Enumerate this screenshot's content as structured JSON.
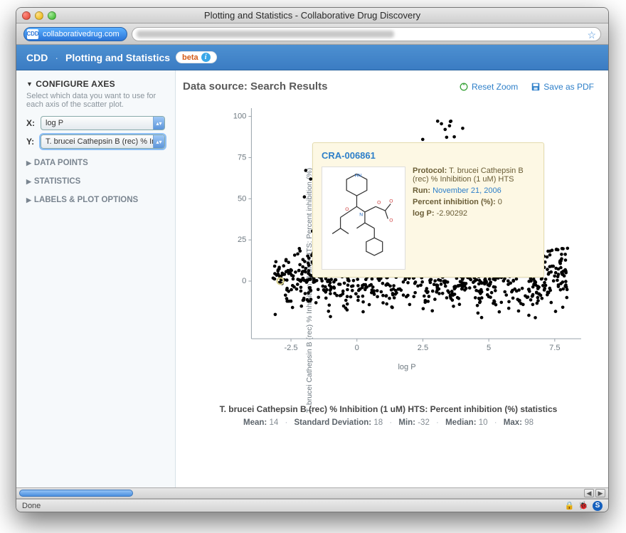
{
  "window": {
    "title": "Plotting and Statistics - Collaborative Drug Discovery"
  },
  "url": {
    "favicon_text": "CDD",
    "domain": "collaborativedrug.com"
  },
  "header": {
    "brand": "CDD",
    "page": "Plotting and Statistics",
    "badge_label": "beta"
  },
  "sidebar": {
    "configure_title": "CONFIGURE AXES",
    "configure_desc": "Select which data you want to use for each axis of the scatter plot.",
    "x_label": "X:",
    "y_label": "Y:",
    "x_select": "log P",
    "y_select": "T. brucei Cathepsin B (rec) % In",
    "sections": [
      "DATA POINTS",
      "STATISTICS",
      "LABELS & PLOT OPTIONS"
    ]
  },
  "main": {
    "title": "Data source: Search Results",
    "reset_zoom": "Reset Zoom",
    "save_pdf": "Save as PDF",
    "xlabel": "log P",
    "ylabel": "T. brucei Cathepsin B (rec) % Inhibition (1 uM) HTS: Percent inhibition (%)"
  },
  "tooltip": {
    "id": "CRA-006861",
    "protocol_label": "Protocol:",
    "protocol": "T. brucei Cathepsin B (rec) % Inhibition (1 uM) HTS",
    "run_label": "Run:",
    "run": "November 21, 2006",
    "pct_label": "Percent inhibition (%):",
    "pct": "0",
    "logp_label": "log P:",
    "logp": "-2.90292"
  },
  "stats": {
    "title": "T. brucei Cathepsin B (rec) % Inhibition (1 uM) HTS: Percent inhibition (%) statistics",
    "mean_label": "Mean:",
    "mean": "14",
    "sd_label": "Standard Deviation:",
    "sd": "18",
    "min_label": "Min:",
    "min": "-32",
    "median_label": "Median:",
    "median": "10",
    "max_label": "Max:",
    "max": "98"
  },
  "statusbar": {
    "text": "Done"
  },
  "chart_data": {
    "type": "scatter",
    "xlabel": "log P",
    "ylabel": "T. brucei Cathepsin B (rec) % Inhibition (1 uM) HTS: Percent inhibition (%)",
    "xlim": [
      -4,
      8.5
    ],
    "ylim": [
      -35,
      105
    ],
    "xticks": [
      -2.5,
      0,
      2.5,
      5,
      7.5
    ],
    "yticks": [
      0,
      25,
      50,
      75,
      100
    ],
    "n_points_approx": 900,
    "highlighted_point": {
      "x": -2.90292,
      "y": 0,
      "id": "CRA-006861"
    },
    "distribution_note": "Most points lie in a dense band between y≈-30 and y≈15 across x≈-3 to 8, with a vertical streak of high values (y 50–98) around x≈3.5–4.5 and a few scattered above y=25 elsewhere.",
    "stats": {
      "mean": 14,
      "sd": 18,
      "min": -32,
      "median": 10,
      "max": 98
    }
  }
}
